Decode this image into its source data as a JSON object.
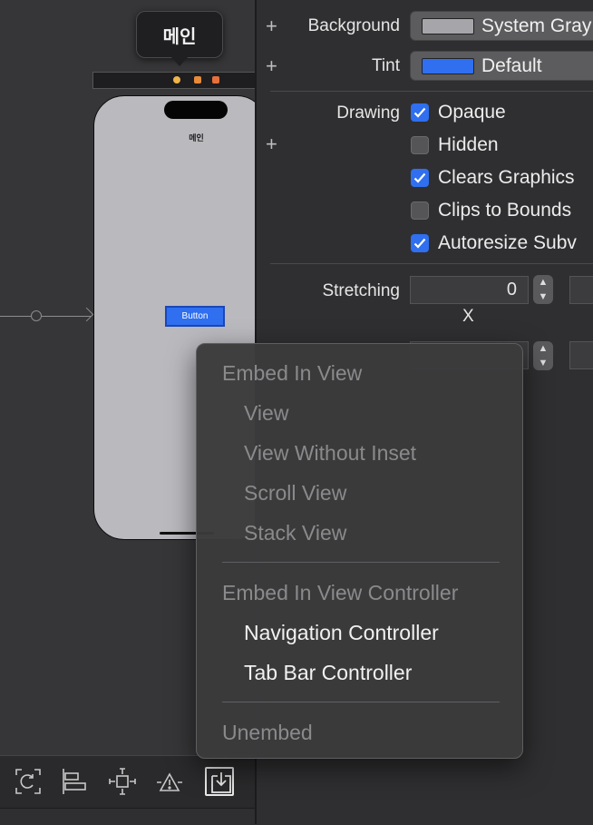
{
  "canvas": {
    "scene_tooltip": "메인",
    "scene_title": "메인",
    "button_label": "Button"
  },
  "inspector": {
    "background": {
      "label": "Background",
      "value": "System Gray",
      "swatch_color": "#a6a6aa"
    },
    "tint": {
      "label": "Tint",
      "value": "Default",
      "swatch_color": "#2f6ff0"
    },
    "drawing": {
      "label": "Drawing",
      "options": [
        {
          "label": "Opaque",
          "checked": true
        },
        {
          "label": "Hidden",
          "checked": false
        },
        {
          "label": "Clears Graphics",
          "checked": true
        },
        {
          "label": "Clips to Bounds",
          "checked": false
        },
        {
          "label": "Autoresize Subv",
          "checked": true
        }
      ]
    },
    "stretching": {
      "label": "Stretching",
      "x_value": "0",
      "x_caption": "X"
    }
  },
  "context_menu": {
    "embed_in_view_header": "Embed In View",
    "view_items": [
      "View",
      "View Without Inset",
      "Scroll View",
      "Stack View"
    ],
    "embed_in_vc_header": "Embed In View Controller",
    "vc_items": [
      "Navigation Controller",
      "Tab Bar Controller"
    ],
    "unembed": "Unembed"
  },
  "toolbar": {
    "icons": [
      "update-frames-icon",
      "align-icon",
      "add-constraints-icon",
      "resolve-issues-icon",
      "embed-in-icon"
    ]
  }
}
